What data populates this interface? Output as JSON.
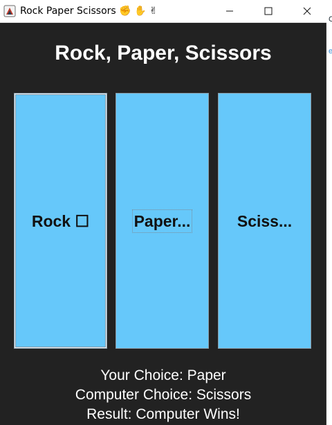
{
  "window": {
    "title": "Rock Paper Scissors ✊ ✋ ✌",
    "controls": {
      "minimize": "—",
      "maximize": "☐",
      "close": "✕"
    }
  },
  "game": {
    "heading": "Rock, Paper, Scissors",
    "buttons": {
      "rock": "Rock ☐",
      "paper": "Paper...",
      "scissors": "Sciss..."
    },
    "results": {
      "your_choice": "Your Choice: Paper",
      "computer_choice": "Computer Choice: Scissors",
      "result": "Result: Computer Wins!"
    }
  },
  "edge": {
    "glyph_top": "C",
    "glyph_mid": "e"
  },
  "colors": {
    "window_bg": "#222222",
    "button_bg": "#66c8fa",
    "text_light": "#ffffff"
  }
}
